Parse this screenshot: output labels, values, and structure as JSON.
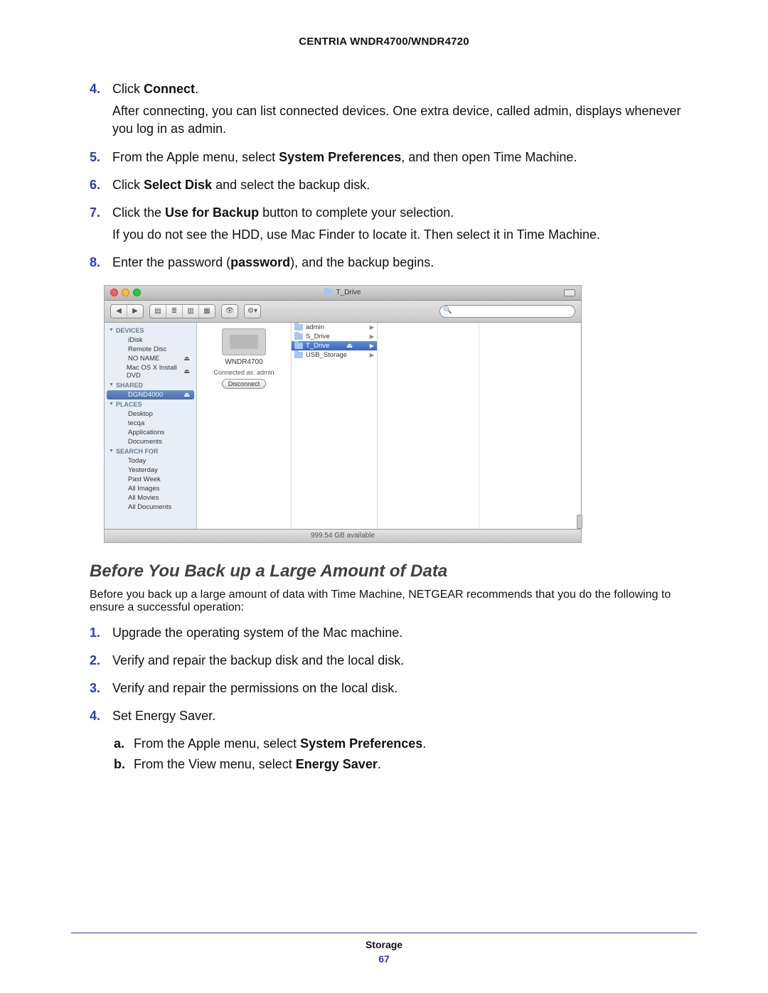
{
  "header": {
    "product": "CENTRIA WNDR4700/WNDR4720"
  },
  "steps": [
    {
      "n": "4.",
      "lines": [
        "Click <b>Connect</b>.",
        "After connecting, you can list connected devices. One extra device, called admin, displays whenever you log in as admin."
      ]
    },
    {
      "n": "5.",
      "lines": [
        "From the Apple menu, select <b>System Preferences</b>, and then open Time Machine."
      ]
    },
    {
      "n": "6.",
      "lines": [
        "Click <b>Select Disk</b> and select the backup disk."
      ]
    },
    {
      "n": "7.",
      "lines": [
        "Click the <b>Use for Backup</b> button to complete your selection.",
        "If you do not see the HDD, use Mac Finder to locate it. Then select it in Time Machine."
      ]
    },
    {
      "n": "8.",
      "lines": [
        "Enter the password (<b>password</b>), and the backup begins."
      ]
    }
  ],
  "finder": {
    "title": "T_Drive",
    "sidebar": {
      "devices": {
        "label": "DEVICES",
        "items": [
          {
            "label": "iDisk"
          },
          {
            "label": "Remote Disc"
          },
          {
            "label": "NO NAME",
            "eject": true
          },
          {
            "label": "Mac OS X Install DVD",
            "eject": true
          }
        ]
      },
      "shared": {
        "label": "SHARED",
        "items": [
          {
            "label": "DGND4000",
            "eject": true,
            "selected": true
          }
        ]
      },
      "places": {
        "label": "PLACES",
        "items": [
          {
            "label": "Desktop"
          },
          {
            "label": "tecqa"
          },
          {
            "label": "Applications"
          },
          {
            "label": "Documents"
          }
        ]
      },
      "search": {
        "label": "SEARCH FOR",
        "items": [
          {
            "label": "Today"
          },
          {
            "label": "Yesterday"
          },
          {
            "label": "Past Week"
          },
          {
            "label": "All Images"
          },
          {
            "label": "All Movies"
          },
          {
            "label": "All Documents"
          }
        ]
      }
    },
    "device_name": "WNDR4700",
    "connected_as": "Connected as: admin",
    "disconnect": "Disconnect",
    "folders": [
      {
        "label": "admin"
      },
      {
        "label": "S_Drive"
      },
      {
        "label": "T_Drive",
        "selected": true,
        "eject": true
      },
      {
        "label": "USB_Storage"
      }
    ],
    "status": "999.54 GB available"
  },
  "section": {
    "heading": "Before You Back up a Large Amount of Data",
    "intro": "Before you back up a large amount of data with Time Machine, NETGEAR recommends that you do the following to ensure a successful operation:",
    "list": [
      {
        "n": "1.",
        "text": "Upgrade the operating system of the Mac machine."
      },
      {
        "n": "2.",
        "text": "Verify and repair the backup disk and the local disk."
      },
      {
        "n": "3.",
        "text": "Verify and repair the permissions on the local disk."
      },
      {
        "n": "4.",
        "text": "Set Energy Saver.",
        "sub": [
          {
            "m": "a.",
            "html": "From the Apple menu, select <b>System Preferences</b>."
          },
          {
            "m": "b.",
            "html": "From the View menu, select <b>Energy Saver</b>."
          }
        ]
      }
    ]
  },
  "footer": {
    "category": "Storage",
    "page": "67"
  }
}
